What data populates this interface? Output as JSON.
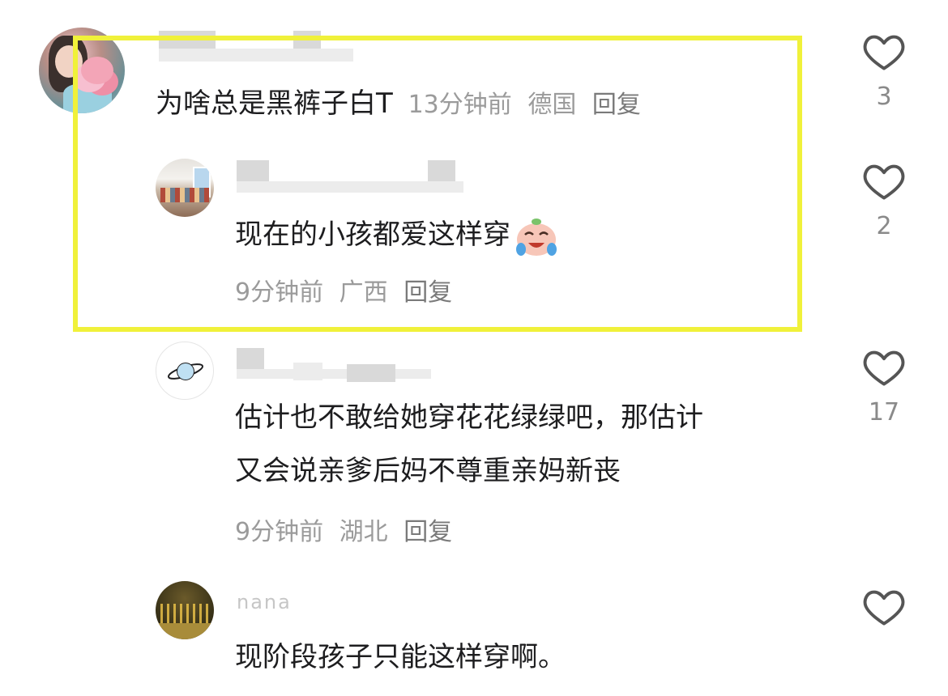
{
  "comments": [
    {
      "text": "为啥总是黑裤子白T",
      "time": "13分钟前",
      "location": "德国",
      "reply_label": "回复",
      "likes": "3"
    },
    {
      "text": "现在的小孩都爱这样穿",
      "time": "9分钟前",
      "location": "广西",
      "reply_label": "回复",
      "likes": "2",
      "emoji": "crying-laughing-emoji"
    },
    {
      "text_line1": "估计也不敢给她穿花花绿绿吧，那估计",
      "text_line2": "又会说亲爹后妈不尊重亲妈新丧",
      "time": "9分钟前",
      "location": "湖北",
      "reply_label": "回复",
      "likes": "17"
    },
    {
      "username": "nana",
      "text": "现阶段孩子只能这样穿啊。",
      "likes": ""
    }
  ],
  "colors": {
    "highlight_border": "#f0f13a",
    "meta_text": "#9b9b9b",
    "body_text": "#1d1d1f"
  },
  "icons": [
    "heart-outline-icon",
    "planet-icon"
  ]
}
